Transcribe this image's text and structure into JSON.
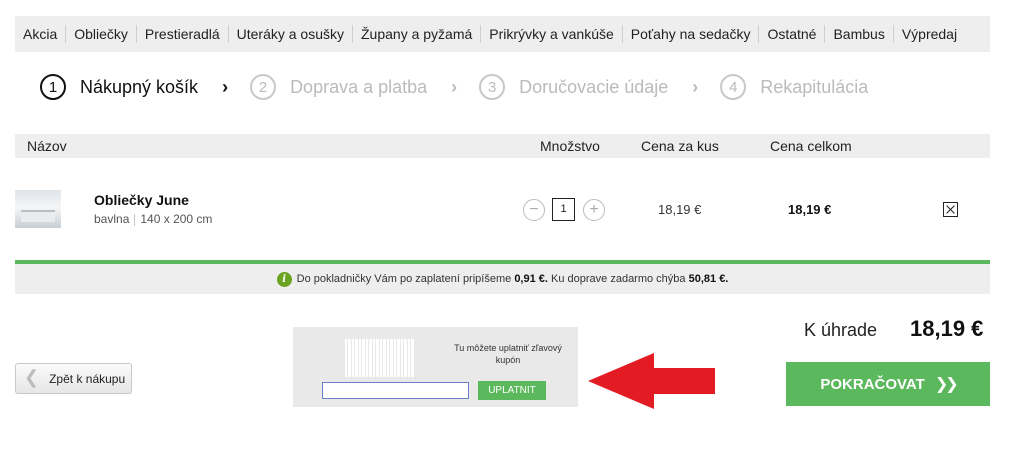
{
  "nav": {
    "items": [
      "Akcia",
      "Obliečky",
      "Prestieradlá",
      "Uteráky a osušky",
      "Župany a pyžamá",
      "Prikrývky a vankúše",
      "Poťahy na sedačky",
      "Ostatné",
      "Bambus",
      "Výpredaj"
    ]
  },
  "steps": [
    {
      "num": "1",
      "label": "Nákupný košík",
      "active": true
    },
    {
      "num": "2",
      "label": "Doprava a platba",
      "active": false
    },
    {
      "num": "3",
      "label": "Doručovacie údaje",
      "active": false
    },
    {
      "num": "4",
      "label": "Rekapitulácia",
      "active": false
    }
  ],
  "step_separator": "›",
  "table": {
    "col_name": "Názov",
    "col_qty": "Množstvo",
    "col_unit": "Cena za kus",
    "col_total": "Cena celkom"
  },
  "product": {
    "name": "Obliečky June",
    "material": "bavlna",
    "size": "140 x 200 cm",
    "qty": "1",
    "minus": "−",
    "plus": "+",
    "unit_price": "18,19 €",
    "total_price": "18,19 €"
  },
  "info": {
    "icon": "i",
    "text_1": "Do pokladničky Vám po zaplatení pripíšeme",
    "amount_1": "0,91 €.",
    "text_2": "Ku doprave zadarmo chýba",
    "amount_2": "50,81 €."
  },
  "total": {
    "label": "K úhrade",
    "value": "18,19 €"
  },
  "back_button": {
    "chevron": "❮",
    "label": "Zpět k nákupu"
  },
  "coupon": {
    "text": "Tu môžete uplatniť zľavový kupón",
    "input_value": "",
    "button": "UPLATNIT"
  },
  "continue_button": {
    "label": "POKRAČOVAT",
    "chevron": "❯❯"
  },
  "colors": {
    "accent_green": "#5cb85c",
    "arrow_red": "#e31c23",
    "bar_gray": "#eeeeee"
  }
}
